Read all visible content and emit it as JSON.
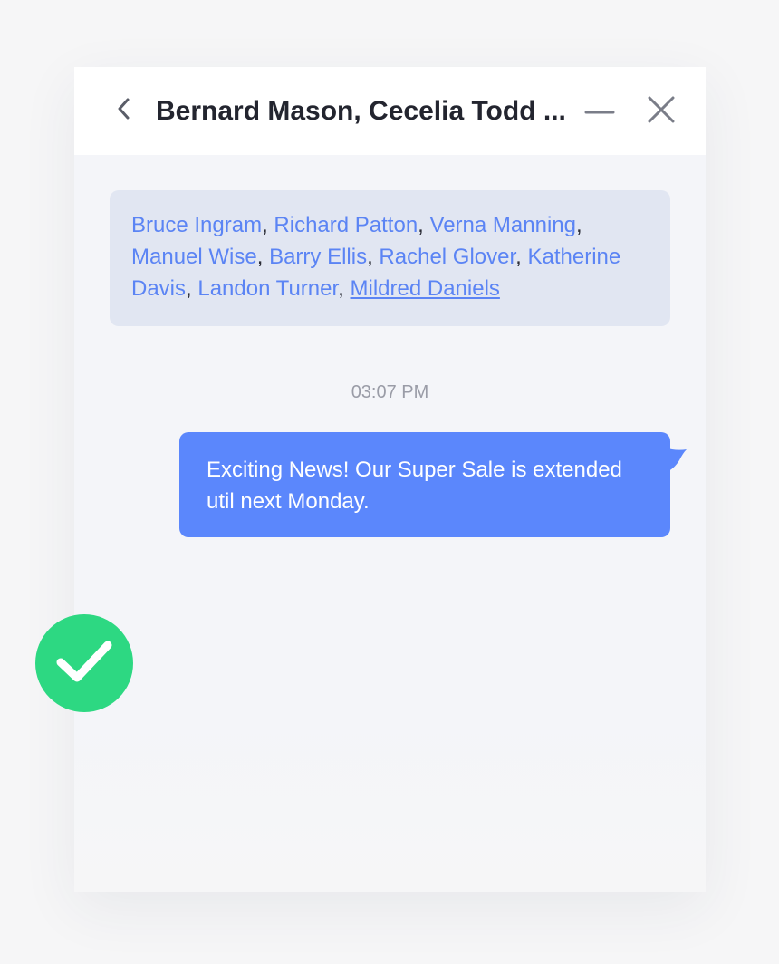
{
  "header": {
    "title": "Bernard Mason, Cecelia Todd ...",
    "back_icon": "chevron-left-icon",
    "minimize_icon": "minus-icon",
    "close_icon": "close-icon"
  },
  "participants": [
    {
      "name": "Bruce Ingram",
      "sep": ", "
    },
    {
      "name": "Richard Patton",
      "sep": ", "
    },
    {
      "name": "Verna Manning",
      "sep": ", "
    },
    {
      "name": "Manuel Wise",
      "sep": ", "
    },
    {
      "name": "Barry Ellis",
      "sep": ", "
    },
    {
      "name": "Rachel Glover",
      "sep": ", "
    },
    {
      "name": "Katherine Davis",
      "sep": ", "
    },
    {
      "name": "Landon Turner",
      "sep": ", "
    },
    {
      "name": "Mildred Daniels",
      "sep": ""
    }
  ],
  "messages": [
    {
      "time": "03:07 PM",
      "text": "Exciting News! Our Super Sale is extended util next Monday."
    }
  ],
  "status": {
    "icon": "checkmark-icon"
  },
  "colors": {
    "accent": "#5b87fc",
    "link": "#5b84f4",
    "participants_bg": "#e1e6f2",
    "success": "#2dd882",
    "title": "#23252f"
  }
}
